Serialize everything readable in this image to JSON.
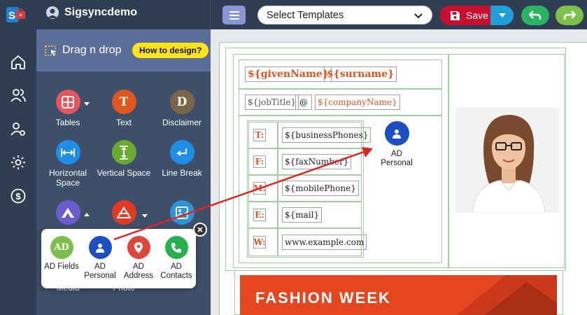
{
  "topbar": {
    "account_name": "Sigsyncdemo",
    "template_select": "Select Templates",
    "save_label": "Save"
  },
  "panel": {
    "title": "Drag n drop",
    "how_to": "How to design?",
    "tools": {
      "tables": "Tables",
      "text": "Text",
      "disclaimer": "Disclaimer",
      "horizontal_space": "Horizontal Space",
      "vertical_space": "Vertical Space",
      "line_break": "Line Break",
      "media": "Media",
      "photo": "Photo"
    },
    "tool_glyphs": {
      "text": "T",
      "disclaimer": "D"
    }
  },
  "popup": {
    "ad_fields": "AD Fields",
    "ad_personal": "AD Personal",
    "ad_address": "AD Address",
    "ad_contacts": "AD Contacts",
    "ad_fields_glyph": "AD"
  },
  "signature": {
    "given_name": "${givenName}",
    "surname": "${surname}",
    "job_title": "${jobTitle}",
    "at": "@",
    "company_name": "${companyName}",
    "rows": [
      {
        "label": "T:",
        "value": "${businessPhones}"
      },
      {
        "label": "F:",
        "value": "${faxNumber}"
      },
      {
        "label": "M:",
        "value": "${mobilePhone}"
      },
      {
        "label": "E:",
        "value": "${mail}"
      },
      {
        "label": "W:",
        "value": "www.example.com"
      }
    ],
    "dropped_block": "AD Personal",
    "banner_text": "FASHION WEEK"
  },
  "colors": {
    "topbar": "#2f3e52",
    "panel": "#3e4f6a",
    "panel_head": "#5b6e99",
    "accent_yellow": "#ffe419",
    "save_red": "#c8102e",
    "field_orange": "#e0541f",
    "arrow_red": "#e02424"
  }
}
